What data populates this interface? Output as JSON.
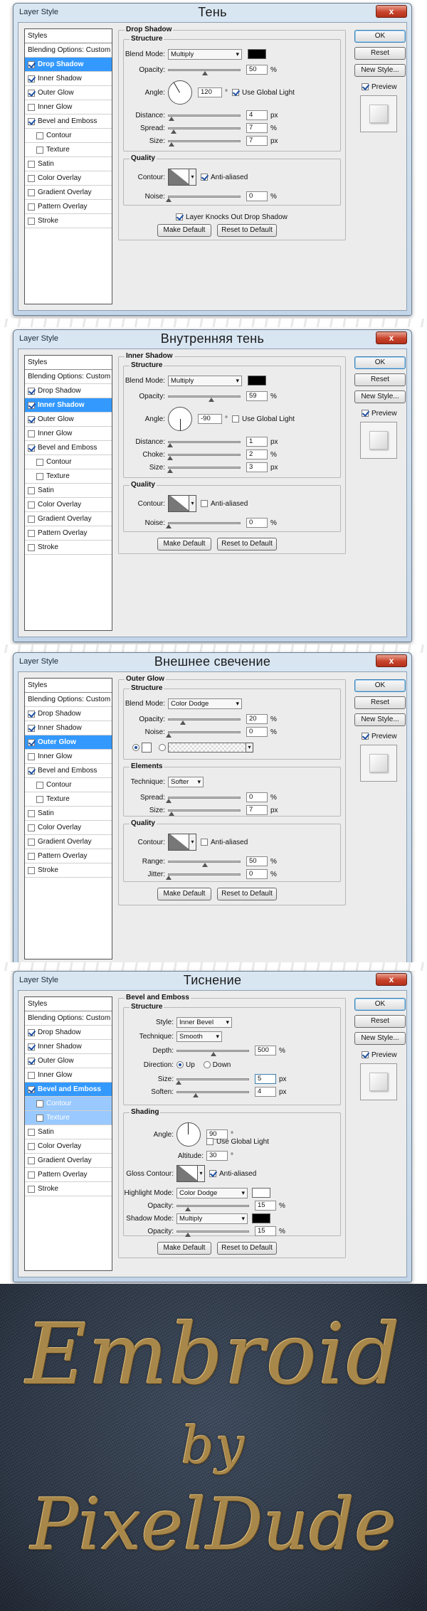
{
  "window_title": "Layer Style",
  "close_label": "x",
  "styles_header": "Styles",
  "effects": [
    "Blending Options: Custom",
    "Drop Shadow",
    "Inner Shadow",
    "Outer Glow",
    "Inner Glow",
    "Bevel and Emboss",
    "Contour",
    "Texture",
    "Satin",
    "Color Overlay",
    "Gradient Overlay",
    "Pattern Overlay",
    "Stroke"
  ],
  "buttons": {
    "ok": "OK",
    "reset": "Reset",
    "new_style": "New Style...",
    "preview": "Preview",
    "make_default": "Make Default",
    "reset_default": "Reset to Default"
  },
  "dialog1": {
    "caption": "Тень",
    "section": "Drop Shadow",
    "structure": "Structure",
    "blend_mode_label": "Blend Mode:",
    "blend_mode": "Multiply",
    "color": "#000000",
    "opacity_label": "Opacity:",
    "opacity": "50",
    "opacity_level": 0.5,
    "angle_label": "Angle:",
    "angle": "120",
    "global_light": "Use Global Light",
    "distance_label": "Distance:",
    "distance": "4",
    "distance_level": 0.03,
    "spread_label": "Spread:",
    "spread": "7",
    "spread_level": 0.07,
    "size_label": "Size:",
    "size": "7",
    "size_level": 0.03,
    "quality": "Quality",
    "contour_label": "Contour:",
    "anti_aliased": "Anti-aliased",
    "noise_label": "Noise:",
    "noise": "0",
    "knockout": "Layer Knocks Out Drop Shadow"
  },
  "dialog2": {
    "caption": "Внутренняя тень",
    "section": "Inner Shadow",
    "structure": "Structure",
    "blend_mode_label": "Blend Mode:",
    "blend_mode": "Multiply",
    "color": "#000000",
    "opacity_label": "Opacity:",
    "opacity": "59",
    "opacity_level": 0.59,
    "angle_label": "Angle:",
    "angle": "-90",
    "global_light": "Use Global Light",
    "distance_label": "Distance:",
    "distance": "1",
    "distance_level": 0.01,
    "choke_label": "Choke:",
    "choke": "2",
    "choke_level": 0.02,
    "size_label": "Size:",
    "size": "3",
    "size_level": 0.01,
    "quality": "Quality",
    "contour_label": "Contour:",
    "anti_aliased": "Anti-aliased",
    "noise_label": "Noise:",
    "noise": "0"
  },
  "dialog3": {
    "caption": "Внешнее свечение",
    "section": "Outer Glow",
    "structure": "Structure",
    "blend_mode_label": "Blend Mode:",
    "blend_mode": "Color Dodge",
    "opacity_label": "Opacity:",
    "opacity": "20",
    "opacity_level": 0.2,
    "noise_label": "Noise:",
    "noise": "0",
    "elements": "Elements",
    "technique_label": "Technique:",
    "technique": "Softer",
    "spread_label": "Spread:",
    "spread": "0",
    "size_label": "Size:",
    "size": "7",
    "size_level": 0.03,
    "quality": "Quality",
    "contour_label": "Contour:",
    "anti_aliased": "Anti-aliased",
    "range_label": "Range:",
    "range": "50",
    "range_level": 0.5,
    "jitter_label": "Jitter:",
    "jitter": "0"
  },
  "dialog4": {
    "caption": "Тиснение",
    "section": "Bevel and Emboss",
    "structure": "Structure",
    "style_label": "Style:",
    "style": "Inner Bevel",
    "technique_label": "Technique:",
    "technique": "Smooth",
    "depth_label": "Depth:",
    "depth": "500",
    "depth_level": 0.5,
    "direction_label": "Direction:",
    "dir_up": "Up",
    "dir_down": "Down",
    "size_label": "Size:",
    "size": "5",
    "size_level": 0.02,
    "soften_label": "Soften:",
    "soften": "4",
    "soften_level": 0.25,
    "shading": "Shading",
    "angle_label": "Angle:",
    "angle": "90",
    "global_light": "Use Global Light",
    "altitude_label": "Altitude:",
    "altitude": "30",
    "gloss_label": "Gloss Contour:",
    "anti_aliased": "Anti-aliased",
    "highlight_label": "Highlight Mode:",
    "highlight_mode": "Color Dodge",
    "highlight_color": "#ffffff",
    "hl_opacity_label": "Opacity:",
    "hl_opacity": "15",
    "hl_opacity_level": 0.15,
    "shadow_label": "Shadow Mode:",
    "shadow_mode": "Multiply",
    "shadow_color": "#000000",
    "sh_opacity_label": "Opacity:",
    "sh_opacity": "15",
    "sh_opacity_level": 0.15
  },
  "artwork": {
    "line1": "Embroid",
    "line2": "by",
    "line3": "PixelDude"
  }
}
